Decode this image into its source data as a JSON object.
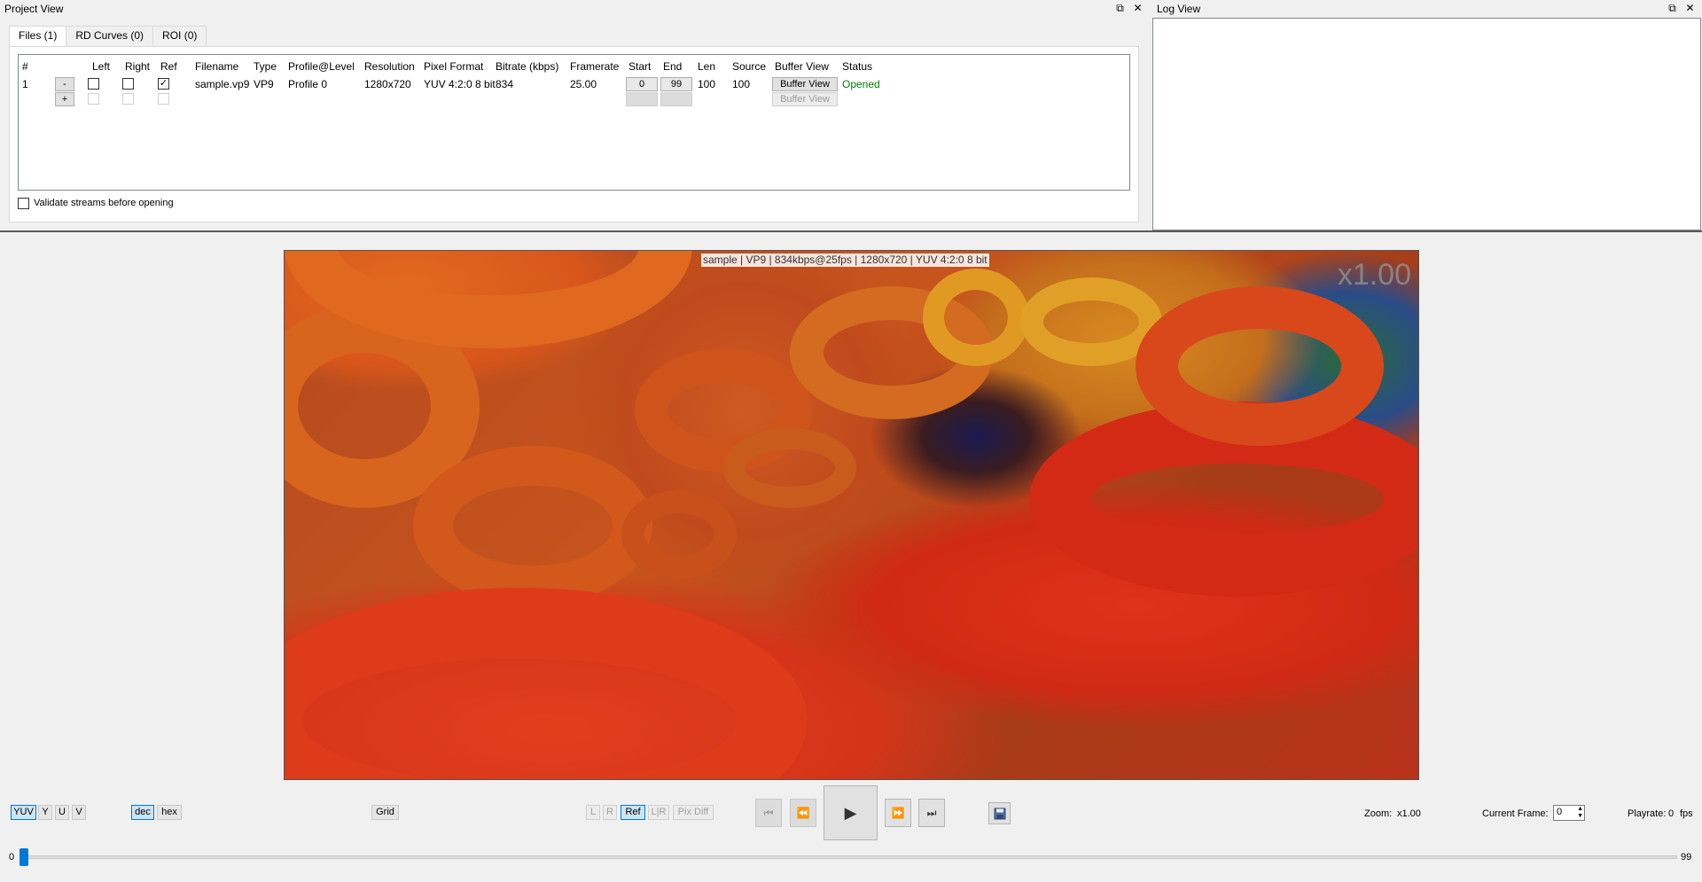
{
  "project_view": {
    "title": "Project View",
    "tabs": [
      {
        "label": "Files (1)",
        "active": true
      },
      {
        "label": "RD Curves (0)",
        "active": false
      },
      {
        "label": "ROI (0)",
        "active": false
      }
    ],
    "columns": [
      "#",
      "Left",
      "Right",
      "Ref",
      "Filename",
      "Type",
      "Profile@Level",
      "Resolution",
      "Pixel Format",
      "Bitrate (kbps)",
      "Framerate",
      "Start",
      "End",
      "Len",
      "Source",
      "Buffer View",
      "Status"
    ],
    "row": {
      "index": "1",
      "remove_label": "-",
      "left_checked": false,
      "right_checked": false,
      "ref_checked": true,
      "filename": "sample.vp9",
      "type": "VP9",
      "profile": "Profile 0",
      "resolution": "1280x720",
      "pixel_format": "YUV 4:2:0 8 bit",
      "bitrate": "834",
      "framerate": "25.00",
      "start": "0",
      "end": "99",
      "len": "100",
      "source": "100",
      "buffer_view_label": "Buffer View",
      "status": "Opened"
    },
    "add_row": {
      "add_label": "+",
      "buffer_view_label": "Buffer View"
    },
    "validate_label": "Validate streams before opening",
    "validate_checked": false
  },
  "log_view": {
    "title": "Log View"
  },
  "dock_buttons": {
    "float": "⧉",
    "close": "✕"
  },
  "video": {
    "info_overlay": "sample | VP9 | 834kbps@25fps | 1280x720 | YUV 4:2:0 8 bit",
    "zoom_overlay": "x1.00"
  },
  "toolbar": {
    "plane_buttons": [
      {
        "label": "YUV",
        "on": true
      },
      {
        "label": "Y",
        "on": false
      },
      {
        "label": "U",
        "on": false
      },
      {
        "label": "V",
        "on": false
      }
    ],
    "base_buttons": [
      {
        "label": "dec",
        "on": true
      },
      {
        "label": "hex",
        "on": false
      }
    ],
    "grid_label": "Grid",
    "view_buttons": [
      {
        "label": "L",
        "state": "disabled"
      },
      {
        "label": "R",
        "state": "disabled"
      },
      {
        "label": "Ref",
        "state": "on"
      },
      {
        "label": "L|R",
        "state": "disabled"
      },
      {
        "label": "Pix Diff",
        "state": "disabled"
      }
    ],
    "media": {
      "first": "⏮",
      "prev": "⏪",
      "play": "▶",
      "next": "⏩",
      "last": "⏭",
      "save_icon": "save-icon"
    },
    "zoom_label": "Zoom:",
    "zoom_value": "x1.00",
    "current_frame_label": "Current Frame:",
    "current_frame_value": "0",
    "playrate_label": "Playrate:",
    "playrate_value": "0",
    "playrate_unit": "fps"
  },
  "timeline": {
    "min": "0",
    "max": "99",
    "position": 0
  },
  "colors": {
    "status_opened": "#008000",
    "accent": "#0078d7"
  }
}
